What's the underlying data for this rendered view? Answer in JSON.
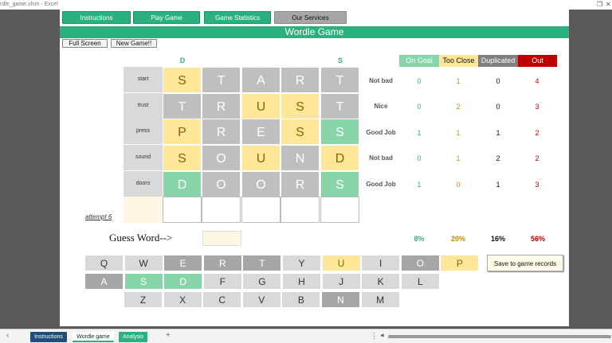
{
  "window": {
    "title": "rdle_game.xlsm - Excel",
    "restore_glyph": "❐",
    "close_glyph": "✕"
  },
  "nav": [
    "Instructions",
    "Play Game",
    "Game Statistics",
    "Our Services"
  ],
  "banner": "Wordle Game",
  "buttons": {
    "full_screen": "Full Screen",
    "new_game": "New Game!!"
  },
  "hints": [
    {
      "letter": "D"
    },
    {
      "letter": "S"
    }
  ],
  "attempts": [
    {
      "word": "start",
      "letters": [
        "S",
        "T",
        "A",
        "R",
        "T"
      ],
      "states": [
        "y",
        "g",
        "g",
        "g",
        "g"
      ],
      "verdict": "Not bad",
      "on_goal": "0",
      "too_close": "1",
      "duplicated": "0",
      "out": "4"
    },
    {
      "word": "trust",
      "letters": [
        "T",
        "R",
        "U",
        "S",
        "T"
      ],
      "states": [
        "g",
        "g",
        "y",
        "y",
        "g"
      ],
      "verdict": "Nice",
      "on_goal": "0",
      "too_close": "2",
      "duplicated": "0",
      "out": "3"
    },
    {
      "word": "press",
      "letters": [
        "P",
        "R",
        "E",
        "S",
        "S"
      ],
      "states": [
        "y",
        "g",
        "g",
        "y",
        "gr"
      ],
      "verdict": "Good Job",
      "on_goal": "1",
      "too_close": "1",
      "duplicated": "1",
      "out": "2"
    },
    {
      "word": "sound",
      "letters": [
        "S",
        "O",
        "U",
        "N",
        "D"
      ],
      "states": [
        "y",
        "g",
        "y",
        "g",
        "y"
      ],
      "verdict": "Not bad",
      "on_goal": "0",
      "too_close": "1",
      "duplicated": "2",
      "out": "2"
    },
    {
      "word": "doors",
      "letters": [
        "D",
        "O",
        "O",
        "R",
        "S"
      ],
      "states": [
        "gr",
        "g",
        "g",
        "g",
        "gr"
      ],
      "verdict": "Good Job",
      "on_goal": "1",
      "too_close": "0",
      "duplicated": "1",
      "out": "3"
    }
  ],
  "attempt_label": "attempt 6",
  "stats_headers": [
    "On Goal",
    "Too Close",
    "Duplicated",
    "Out"
  ],
  "stats_colors": {
    "on_goal": "#89d5aa",
    "too_close": "#ffe699",
    "duplicated": "#7f7f7f",
    "out": "#c00000"
  },
  "percentages": [
    "8%",
    "20%",
    "16%",
    "56%"
  ],
  "guess_label": "Guess Word-->",
  "guess_value": "",
  "save_button": "Save to game records",
  "keyboard": [
    [
      {
        "k": "Q",
        "s": "ku"
      },
      {
        "k": "W",
        "s": "ku"
      },
      {
        "k": "E",
        "s": "kg"
      },
      {
        "k": "R",
        "s": "kg"
      },
      {
        "k": "T",
        "s": "kg"
      },
      {
        "k": "Y",
        "s": "ku"
      },
      {
        "k": "U",
        "s": "ky"
      },
      {
        "k": "I",
        "s": "ku"
      },
      {
        "k": "O",
        "s": "kg"
      },
      {
        "k": "P",
        "s": "ky"
      }
    ],
    [
      {
        "k": "A",
        "s": "kg"
      },
      {
        "k": "S",
        "s": "kgr"
      },
      {
        "k": "D",
        "s": "kgr"
      },
      {
        "k": "F",
        "s": "ku"
      },
      {
        "k": "G",
        "s": "ku"
      },
      {
        "k": "H",
        "s": "ku"
      },
      {
        "k": "J",
        "s": "ku"
      },
      {
        "k": "K",
        "s": "ku"
      },
      {
        "k": "L",
        "s": "ku"
      }
    ],
    [
      {
        "k": "Z",
        "s": "ku"
      },
      {
        "k": "X",
        "s": "ku"
      },
      {
        "k": "C",
        "s": "ku"
      },
      {
        "k": "V",
        "s": "ku"
      },
      {
        "k": "B",
        "s": "ku"
      },
      {
        "k": "N",
        "s": "kg"
      },
      {
        "k": "M",
        "s": "ku"
      }
    ]
  ],
  "sheet_tabs": [
    "Instructions",
    "Wordle game",
    "Analysis"
  ],
  "icons": {
    "nav_left": "‹",
    "add_sheet": "+",
    "more": "⋮",
    "scroll_left": "◀"
  }
}
